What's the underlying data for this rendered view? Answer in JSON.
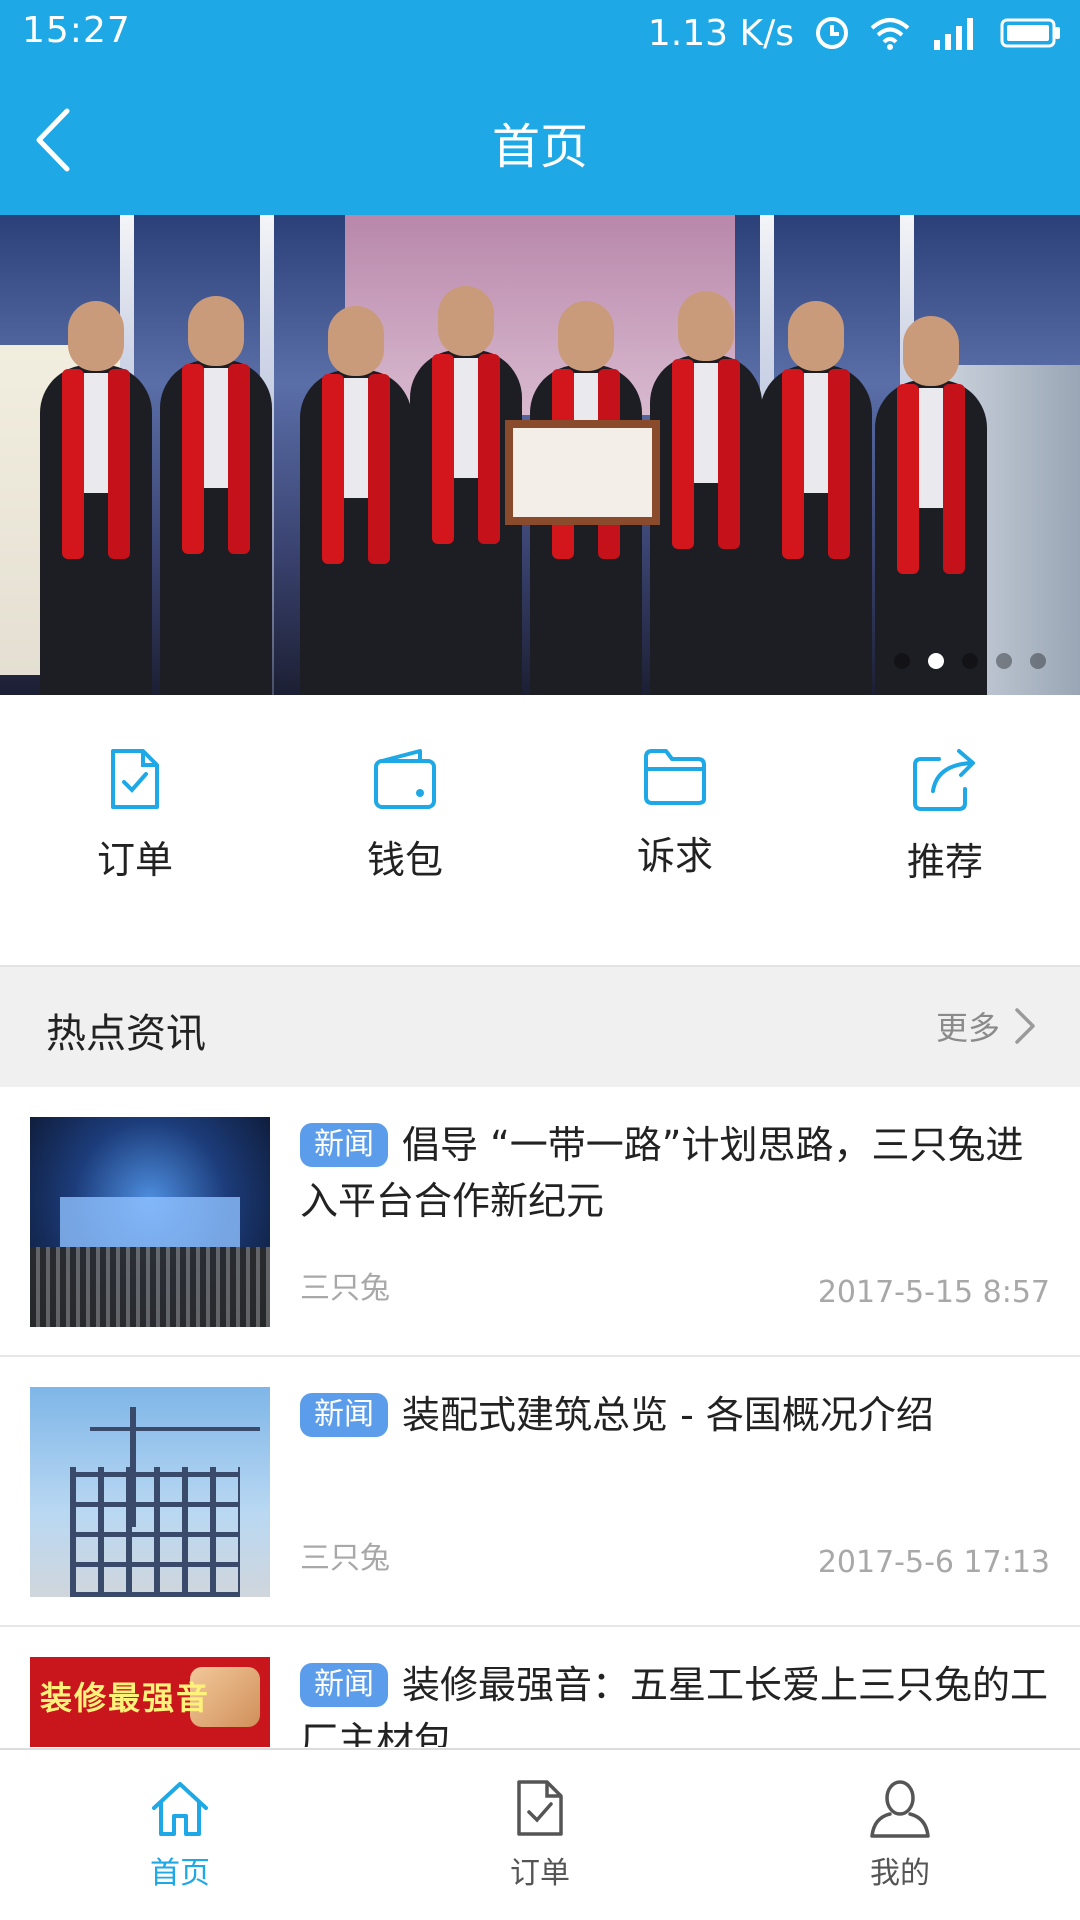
{
  "status_bar": {
    "time": "15:27",
    "net_speed": "1.13 K/s"
  },
  "header": {
    "title": "首页",
    "back_icon": "chevron-left-icon"
  },
  "banner": {
    "dot_count": 5,
    "active_index": 1
  },
  "quick_menu": [
    {
      "label": "订单",
      "icon": "order-document-icon"
    },
    {
      "label": "钱包",
      "icon": "wallet-icon"
    },
    {
      "label": "诉求",
      "icon": "folder-icon"
    },
    {
      "label": "推荐",
      "icon": "share-icon"
    }
  ],
  "section": {
    "title": "热点资讯",
    "more_label": "更多"
  },
  "news": [
    {
      "tag": "新闻",
      "title": "倡导 “一带一路”计划思路，三只兔进入平台合作新纪元",
      "source": "三只兔",
      "time": "2017-5-15 8:57"
    },
    {
      "tag": "新闻",
      "title": "装配式建筑总览 - 各国概况介绍",
      "source": "三只兔",
      "time": "2017-5-6 17:13"
    },
    {
      "tag": "新闻",
      "title": "装修最强音：五星工长爱上三只兔的工厂主材包",
      "source": "",
      "time": ""
    }
  ],
  "news_thumb_ad_text": "装修最强音",
  "bottom_nav": [
    {
      "label": "首页",
      "icon": "home-icon",
      "active": true
    },
    {
      "label": "订单",
      "icon": "order-document-icon",
      "active": false
    },
    {
      "label": "我的",
      "icon": "user-icon",
      "active": false
    }
  ],
  "colors": {
    "primary": "#1ea8e6",
    "tag": "#5b9dea",
    "section_bg": "#f0f0f0"
  }
}
